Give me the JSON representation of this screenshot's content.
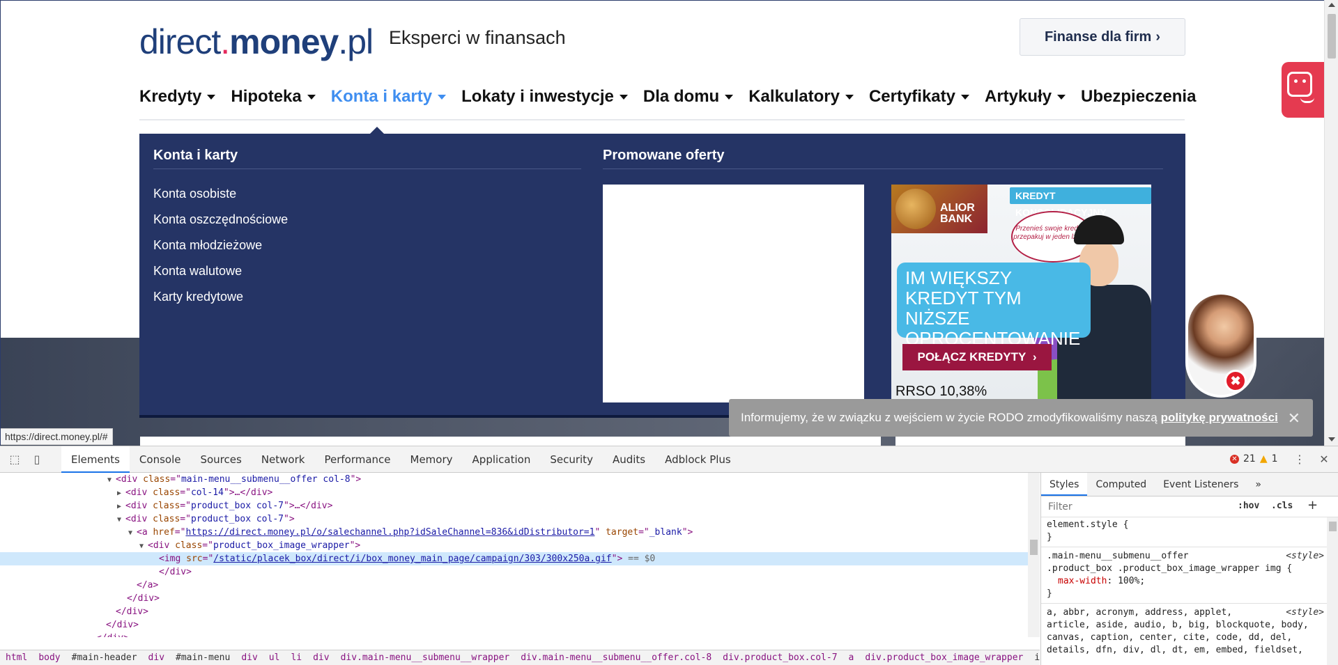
{
  "site": {
    "logo": {
      "part1": "direct",
      "dot": ".",
      "part2": "money",
      "part3": ".pl"
    },
    "tagline": "Eksperci w finansach",
    "firm_button": "Finanse dla firm",
    "nav": [
      {
        "label": "Kredyty",
        "caret": true
      },
      {
        "label": "Hipoteka",
        "caret": true
      },
      {
        "label": "Konta i karty",
        "caret": true,
        "active": true
      },
      {
        "label": "Lokaty i inwestycje",
        "caret": true
      },
      {
        "label": "Dla domu",
        "caret": true
      },
      {
        "label": "Kalkulatory",
        "caret": true
      },
      {
        "label": "Certyfikaty",
        "caret": true
      },
      {
        "label": "Artykuły",
        "caret": true
      },
      {
        "label": "Ubezpieczenia",
        "caret": false
      }
    ],
    "submenu": {
      "title": "Konta i karty",
      "items": [
        "Konta osobiste",
        "Konta oszczędnościowe",
        "Konta młodzieżowe",
        "Konta walutowe",
        "Karty kredytowe"
      ],
      "promo_title": "Promowane oferty"
    },
    "ad": {
      "bank": "ALIOR BANK",
      "bank_line1": "ALIOR",
      "bank_line2": "BANK",
      "label": "KREDYT KONSOLIDACYJNY",
      "bubble": "Przenieś swoje kredyty i przepakuj w jeden lżejszy",
      "headline": "IM WIĘKSZY KREDYT TYM NIŻSZE OPROCENTOWANIE",
      "cta": "POŁĄCZ KREDYTY",
      "rrso": "RRSO 10,38%"
    },
    "rodo": {
      "text": "Informujemy, że w związku z wejściem w życie RODO zmodyfikowaliśmy naszą",
      "link": "politykę prywatności",
      "close": "✕"
    },
    "status_url": "https://direct.money.pl/#",
    "colors": {
      "brand": "#1f3f7a",
      "accent": "#e52a5d",
      "nav_active": "#3f8ef0",
      "submenu_bg": "#253465"
    }
  },
  "devtools": {
    "tabs": [
      "Elements",
      "Console",
      "Sources",
      "Network",
      "Performance",
      "Memory",
      "Application",
      "Security",
      "Audits",
      "Adblock Plus"
    ],
    "active_tab": "Elements",
    "errors": "21",
    "warnings": "1",
    "styles_tabs": [
      "Styles",
      "Computed",
      "Event Listeners",
      "»"
    ],
    "filter_placeholder": "Filter",
    "hov": ":hov",
    "cls": ".cls",
    "dom": {
      "l1_class": "main-menu__submenu__offer col-8",
      "l2_class": "col-14",
      "l3_class": "product_box col-7",
      "l4_class": "product_box col-7",
      "a_href": "https://direct.money.pl/o/salechannel.php?idSaleChannel=836&idDistributor=1",
      "a_target": "_blank",
      "wrap_class": "product_box_image_wrapper",
      "img_src": "/static/placek_box/direct/i/box_money_main_page/campaign/303/300x250a.gif",
      "eq_text": "== $0"
    },
    "breadcrumbs": [
      "html",
      "body",
      "#main-header",
      "div",
      "#main-menu",
      "div",
      "ul",
      "li",
      "div",
      "div.main-menu__submenu__wrapper",
      "div.main-menu__submenu__offer.col-8",
      "div.product_box.col-7",
      "a",
      "div.product_box_image_wrapper",
      "img"
    ],
    "styles": {
      "element_style": "element.style {",
      "close": "}",
      "rule_sel1": ".main-menu__submenu__offer",
      "rule_sel2": ".product_box .product_box_image_wrapper img {",
      "rule_src": "<style>",
      "prop": "max-width",
      "pval": "100%;",
      "ua_lines": [
        "a, abbr, acronym, address, applet,",
        "article, aside, audio, b, big, blockquote, body,",
        "canvas, caption, center, cite, code, dd, del,",
        "details, dfn, div, dl, dt, em, embed, fieldset,"
      ]
    }
  }
}
